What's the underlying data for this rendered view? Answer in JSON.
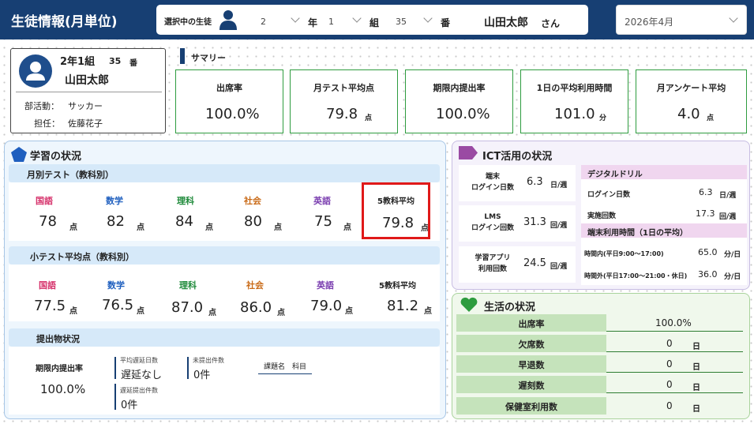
{
  "header": {
    "title": "生徒情報(月単位)",
    "selector_label": "選択中の生徒",
    "grade": "2",
    "grade_unit": "年",
    "class": "1",
    "class_unit": "組",
    "number": "35",
    "number_unit": "番",
    "student_name": "山田太郎",
    "honorific": "さん",
    "month": "2026年4月"
  },
  "student": {
    "class_label": "2年1組",
    "number": "35",
    "number_unit": "番",
    "name": "山田太郎",
    "club_label": "部活動：",
    "club": "サッカー",
    "teacher_label": "担任：",
    "teacher": "佐藤花子"
  },
  "summary": {
    "title": "サマリー",
    "cards": [
      {
        "label": "出席率",
        "value": "100.0%",
        "unit": ""
      },
      {
        "label": "月テスト平均点",
        "value": "79.8",
        "unit": "点"
      },
      {
        "label": "期限内提出率",
        "value": "100.0%",
        "unit": ""
      },
      {
        "label": "1日の平均利用時間",
        "value": "101.0",
        "unit": "分"
      },
      {
        "label": "月アンケート平均",
        "value": "4.0",
        "unit": "点"
      }
    ]
  },
  "learning": {
    "title": "学習の状況",
    "monthly": {
      "title": "月別テスト（教科別）",
      "subjects": [
        {
          "name": "国語",
          "score": "78",
          "unit": "点"
        },
        {
          "name": "数学",
          "score": "82",
          "unit": "点"
        },
        {
          "name": "理科",
          "score": "84",
          "unit": "点"
        },
        {
          "name": "社会",
          "score": "80",
          "unit": "点"
        },
        {
          "name": "英語",
          "score": "75",
          "unit": "点"
        },
        {
          "name": "5教科平均",
          "score": "79.8",
          "unit": "点"
        }
      ]
    },
    "quiz": {
      "title": "小テスト平均点（教科別）",
      "subjects": [
        {
          "name": "国語",
          "score": "77.5",
          "unit": "点"
        },
        {
          "name": "数学",
          "score": "76.5",
          "unit": "点"
        },
        {
          "name": "理科",
          "score": "87.0",
          "unit": "点"
        },
        {
          "name": "社会",
          "score": "86.0",
          "unit": "点"
        },
        {
          "name": "英語",
          "score": "79.0",
          "unit": "点"
        },
        {
          "name": "5教科平均",
          "score": "81.2",
          "unit": "点"
        }
      ]
    },
    "submission": {
      "title": "提出物状況",
      "rate_label": "期限内提出率",
      "rate": "100.0%",
      "avg_delay_label": "平均遅延日数",
      "avg_delay": "遅延なし",
      "late_count_label": "遅延提出件数",
      "late_count": "0件",
      "missing_label": "未提出件数",
      "missing": "0件",
      "table_header": "課題名　科目"
    }
  },
  "ict": {
    "title": "ICT活用の状況",
    "left": [
      {
        "label": "端末\nログイン日数",
        "value": "6.3",
        "unit": "日/週"
      },
      {
        "label": "LMS\nログイン回数",
        "value": "31.3",
        "unit": "回/週"
      },
      {
        "label": "学習アプリ\n利用回数",
        "value": "24.5",
        "unit": "回/週"
      }
    ],
    "drill": {
      "title": "デジタルドリル",
      "rows": [
        {
          "label": "ログイン日数",
          "value": "6.3",
          "unit": "日/週"
        },
        {
          "label": "実施回数",
          "value": "17.3",
          "unit": "回/週"
        }
      ]
    },
    "usage": {
      "title": "端末利用時間（1日の平均）",
      "rows": [
        {
          "label": "時間内(平日9:00～17:00)",
          "value": "65.0",
          "unit": "分/日"
        },
        {
          "label": "時間外(平日17:00～21:00・休日)",
          "value": "36.0",
          "unit": "分/日"
        }
      ]
    }
  },
  "life": {
    "title": "生活の状況",
    "rows": [
      {
        "label": "出席率",
        "value": "100.0%",
        "unit": ""
      },
      {
        "label": "欠席数",
        "value": "0",
        "unit": "日"
      },
      {
        "label": "早退数",
        "value": "0",
        "unit": "日"
      },
      {
        "label": "遅刻数",
        "value": "0",
        "unit": "日"
      },
      {
        "label": "保健室利用数",
        "value": "0",
        "unit": "日"
      }
    ]
  },
  "colors": {
    "navy": "#173f73",
    "green": "#2e9c3f",
    "red_highlight": "#e01919",
    "japanese": "#d6336c",
    "math": "#1f5fbf",
    "science": "#1e8a3a",
    "social": "#c96a17",
    "english": "#7b3fb0"
  }
}
